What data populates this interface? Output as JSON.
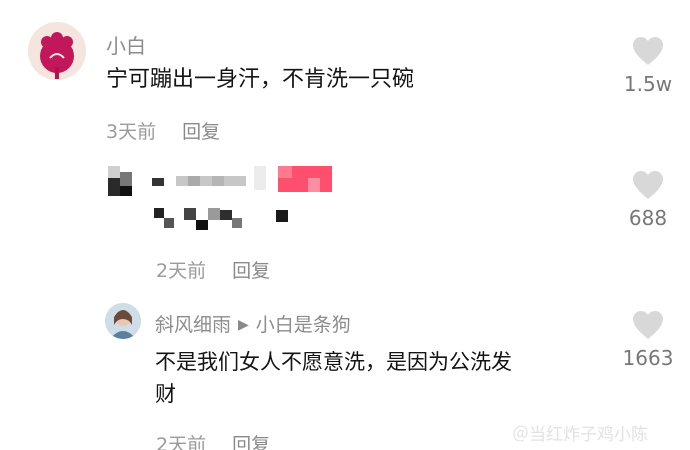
{
  "comments": [
    {
      "username": "小白",
      "text": "宁可蹦出一身汗，不肯洗一只碗",
      "time": "3天前",
      "reply_label": "回复",
      "likes": "1.5w"
    },
    {
      "username": "",
      "text": "",
      "time": "2天前",
      "reply_label": "回复",
      "likes": "688"
    }
  ],
  "reply": {
    "username": "斜风细雨",
    "reply_to": "小白是条狗",
    "text_line1": "不是我们女人不愿意洗，是因为公洗发",
    "text_line2": "财",
    "time": "2天前",
    "reply_label": "回复",
    "likes": "1663"
  },
  "watermark": "＠当红炸子鸡小陈",
  "colors": {
    "avatar_accent": "#c2185b",
    "redaction_pink": "#ff4f6e",
    "like_icon": "#d8d8d8"
  }
}
